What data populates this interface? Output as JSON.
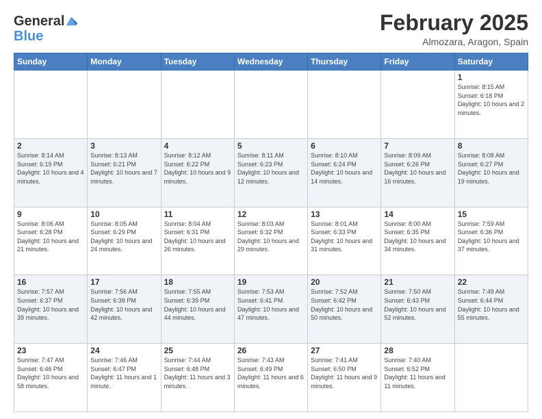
{
  "logo": {
    "general": "General",
    "blue": "Blue"
  },
  "header": {
    "month": "February 2025",
    "location": "Almozara, Aragon, Spain"
  },
  "weekdays": [
    "Sunday",
    "Monday",
    "Tuesday",
    "Wednesday",
    "Thursday",
    "Friday",
    "Saturday"
  ],
  "weeks": [
    [
      {
        "day": "",
        "info": ""
      },
      {
        "day": "",
        "info": ""
      },
      {
        "day": "",
        "info": ""
      },
      {
        "day": "",
        "info": ""
      },
      {
        "day": "",
        "info": ""
      },
      {
        "day": "",
        "info": ""
      },
      {
        "day": "1",
        "info": "Sunrise: 8:15 AM\nSunset: 6:18 PM\nDaylight: 10 hours and 2 minutes."
      }
    ],
    [
      {
        "day": "2",
        "info": "Sunrise: 8:14 AM\nSunset: 6:19 PM\nDaylight: 10 hours and 4 minutes."
      },
      {
        "day": "3",
        "info": "Sunrise: 8:13 AM\nSunset: 6:21 PM\nDaylight: 10 hours and 7 minutes."
      },
      {
        "day": "4",
        "info": "Sunrise: 8:12 AM\nSunset: 6:22 PM\nDaylight: 10 hours and 9 minutes."
      },
      {
        "day": "5",
        "info": "Sunrise: 8:11 AM\nSunset: 6:23 PM\nDaylight: 10 hours and 12 minutes."
      },
      {
        "day": "6",
        "info": "Sunrise: 8:10 AM\nSunset: 6:24 PM\nDaylight: 10 hours and 14 minutes."
      },
      {
        "day": "7",
        "info": "Sunrise: 8:09 AM\nSunset: 6:26 PM\nDaylight: 10 hours and 16 minutes."
      },
      {
        "day": "8",
        "info": "Sunrise: 8:08 AM\nSunset: 6:27 PM\nDaylight: 10 hours and 19 minutes."
      }
    ],
    [
      {
        "day": "9",
        "info": "Sunrise: 8:06 AM\nSunset: 6:28 PM\nDaylight: 10 hours and 21 minutes."
      },
      {
        "day": "10",
        "info": "Sunrise: 8:05 AM\nSunset: 6:29 PM\nDaylight: 10 hours and 24 minutes."
      },
      {
        "day": "11",
        "info": "Sunrise: 8:04 AM\nSunset: 6:31 PM\nDaylight: 10 hours and 26 minutes."
      },
      {
        "day": "12",
        "info": "Sunrise: 8:03 AM\nSunset: 6:32 PM\nDaylight: 10 hours and 29 minutes."
      },
      {
        "day": "13",
        "info": "Sunrise: 8:01 AM\nSunset: 6:33 PM\nDaylight: 10 hours and 31 minutes."
      },
      {
        "day": "14",
        "info": "Sunrise: 8:00 AM\nSunset: 6:35 PM\nDaylight: 10 hours and 34 minutes."
      },
      {
        "day": "15",
        "info": "Sunrise: 7:59 AM\nSunset: 6:36 PM\nDaylight: 10 hours and 37 minutes."
      }
    ],
    [
      {
        "day": "16",
        "info": "Sunrise: 7:57 AM\nSunset: 6:37 PM\nDaylight: 10 hours and 39 minutes."
      },
      {
        "day": "17",
        "info": "Sunrise: 7:56 AM\nSunset: 6:38 PM\nDaylight: 10 hours and 42 minutes."
      },
      {
        "day": "18",
        "info": "Sunrise: 7:55 AM\nSunset: 6:39 PM\nDaylight: 10 hours and 44 minutes."
      },
      {
        "day": "19",
        "info": "Sunrise: 7:53 AM\nSunset: 6:41 PM\nDaylight: 10 hours and 47 minutes."
      },
      {
        "day": "20",
        "info": "Sunrise: 7:52 AM\nSunset: 6:42 PM\nDaylight: 10 hours and 50 minutes."
      },
      {
        "day": "21",
        "info": "Sunrise: 7:50 AM\nSunset: 6:43 PM\nDaylight: 10 hours and 52 minutes."
      },
      {
        "day": "22",
        "info": "Sunrise: 7:49 AM\nSunset: 6:44 PM\nDaylight: 10 hours and 55 minutes."
      }
    ],
    [
      {
        "day": "23",
        "info": "Sunrise: 7:47 AM\nSunset: 6:46 PM\nDaylight: 10 hours and 58 minutes."
      },
      {
        "day": "24",
        "info": "Sunrise: 7:46 AM\nSunset: 6:47 PM\nDaylight: 11 hours and 1 minute."
      },
      {
        "day": "25",
        "info": "Sunrise: 7:44 AM\nSunset: 6:48 PM\nDaylight: 11 hours and 3 minutes."
      },
      {
        "day": "26",
        "info": "Sunrise: 7:43 AM\nSunset: 6:49 PM\nDaylight: 11 hours and 6 minutes."
      },
      {
        "day": "27",
        "info": "Sunrise: 7:41 AM\nSunset: 6:50 PM\nDaylight: 11 hours and 9 minutes."
      },
      {
        "day": "28",
        "info": "Sunrise: 7:40 AM\nSunset: 6:52 PM\nDaylight: 11 hours and 11 minutes."
      },
      {
        "day": "",
        "info": ""
      }
    ]
  ]
}
